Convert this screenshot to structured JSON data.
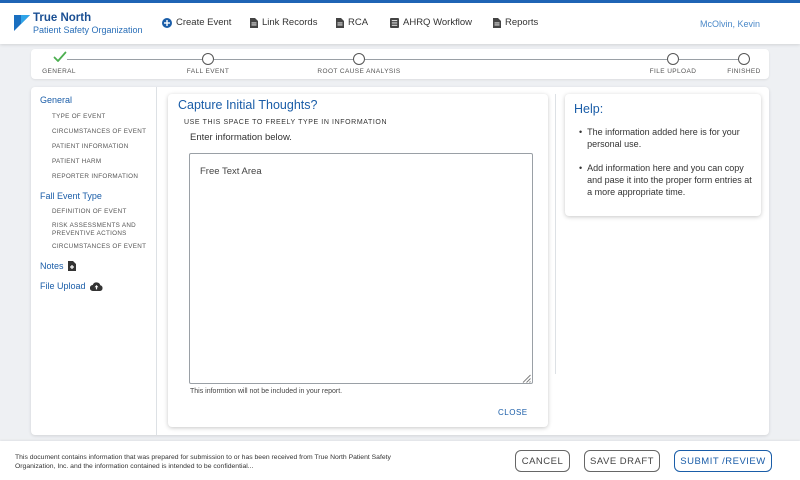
{
  "header": {
    "logo_title": "True North",
    "logo_subtitle": "Patient Safety Organization",
    "nav": [
      {
        "label": "Create Event",
        "icon": "plus-circle-icon"
      },
      {
        "label": "Link Records",
        "icon": "document-icon"
      },
      {
        "label": "RCA",
        "icon": "document-icon"
      },
      {
        "label": "AHRQ Workflow",
        "icon": "document-list-icon"
      },
      {
        "label": "Reports",
        "icon": "document-icon"
      }
    ],
    "user": "McOlvin, Kevin"
  },
  "stepper": {
    "steps": [
      {
        "label": "GENERAL",
        "state": "complete"
      },
      {
        "label": "FALL EVENT",
        "state": "pending"
      },
      {
        "label": "ROOT CAUSE ANALYSIS",
        "state": "pending"
      },
      {
        "label": "FILE UPLOAD",
        "state": "pending"
      },
      {
        "label": "FINISHED",
        "state": "pending"
      }
    ]
  },
  "sidebar": {
    "general_label": "General",
    "general_items": [
      "TYPE OF EVENT",
      "CIRCUMSTANCES OF EVENT",
      "PATIENT INFORMATION",
      "PATIENT HARM",
      "REPORTER INFORMATION"
    ],
    "fall_label": "Fall Event Type",
    "fall_items": [
      "DEFINITION OF EVENT",
      "RISK ASSESSMENTS AND PREVENTIVE ACTIONS",
      "CIRCUMSTANCES OF EVENT"
    ],
    "notes_label": "Notes",
    "file_upload_label": "File Upload"
  },
  "capture": {
    "title": "Capture Initial Thoughts?",
    "subtitle": "USE THIS SPACE TO FREELY TYPE IN INFORMATION",
    "instruction": "Enter information below.",
    "placeholder": "Free Text Area",
    "note": "This informtion will not be included in your report.",
    "close_label": "CLOSE"
  },
  "help": {
    "title": "Help:",
    "items": [
      "The information added here is for your personal use.",
      "Add information here and you can copy and pase it into the proper form entries at a more appropriate time."
    ]
  },
  "footer": {
    "disclaimer": "This document contains information that was prepared for submission to or has been received from True North Patient Safety Organization, Inc. and the information contained is intended to be confidential...",
    "cancel_label": "CANCEL",
    "save_draft_label": "SAVE DRAFT",
    "submit_label": "SUBMIT /REVIEW"
  },
  "colors": {
    "primary": "#1a5da8",
    "accent_blue": "#2fa4e8",
    "complete_green": "#4caf50",
    "background": "#eef0f3"
  }
}
